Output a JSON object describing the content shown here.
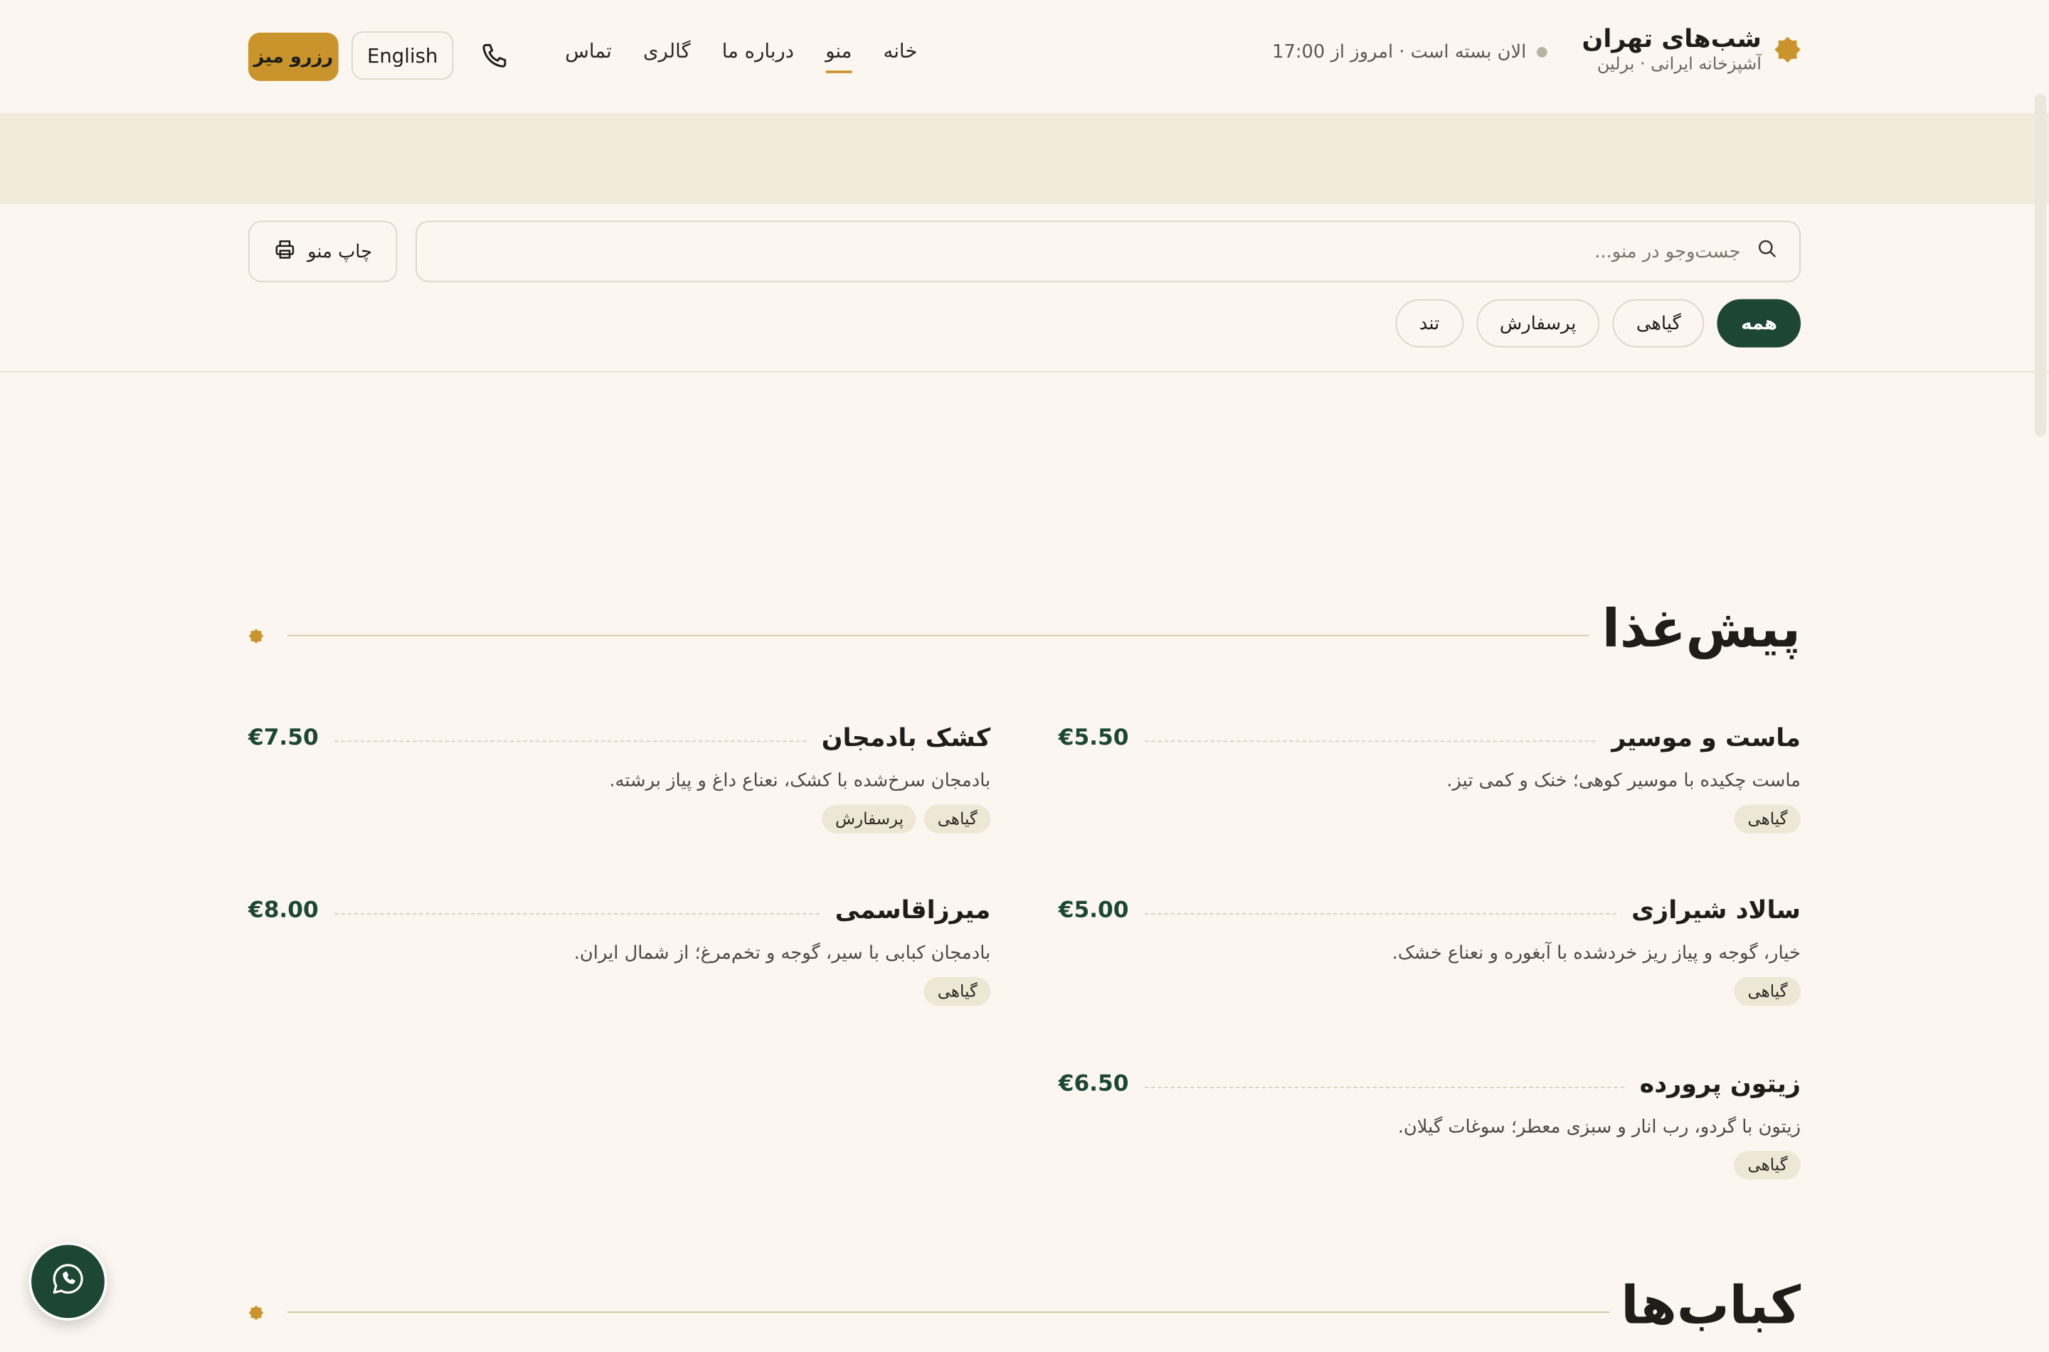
{
  "brand": {
    "name": "شب‌های تهران",
    "subtitle": "آشپزخانه ایرانی · برلین"
  },
  "status": {
    "text": "الان بسته است · امروز از 17:00"
  },
  "nav": {
    "items": [
      {
        "label": "خانه",
        "active": false
      },
      {
        "label": "منو",
        "active": true
      },
      {
        "label": "درباره ما",
        "active": false
      },
      {
        "label": "گالری",
        "active": false
      },
      {
        "label": "تماس",
        "active": false
      }
    ]
  },
  "header": {
    "language_label": "English",
    "reserve_label": "رزرو میز",
    "phone_icon": "phone-icon"
  },
  "search": {
    "placeholder": "جست‌وجو در منو...",
    "value": ""
  },
  "toolbar": {
    "print_label": "چاپ منو"
  },
  "filters": [
    {
      "label": "همه",
      "active": true
    },
    {
      "label": "گیاهی",
      "active": false
    },
    {
      "label": "پرسفارش",
      "active": false
    },
    {
      "label": "تند",
      "active": false
    }
  ],
  "sections": [
    {
      "title": "پیش‌غذا",
      "items": [
        {
          "name": "ماست و موسیر",
          "price": "€5.50",
          "description": "ماست چکیده با موسیر کوهی؛ خنک و کمی تیز.",
          "tags": [
            "گیاهی"
          ]
        },
        {
          "name": "کشک بادمجان",
          "price": "€7.50",
          "description": "بادمجان سرخ‌شده با کشک، نعناع داغ و پیاز برشته.",
          "tags": [
            "گیاهی",
            "پرسفارش"
          ]
        },
        {
          "name": "سالاد شیرازی",
          "price": "€5.00",
          "description": "خیار، گوجه و پیاز ریز خردشده با آبغوره و نعناع خشک.",
          "tags": [
            "گیاهی"
          ]
        },
        {
          "name": "میرزاقاسمی",
          "price": "€8.00",
          "description": "بادمجان کبابی با سیر، گوجه و تخم‌مرغ؛ از شمال ایران.",
          "tags": [
            "گیاهی"
          ]
        },
        {
          "name": "زیتون پرورده",
          "price": "€6.50",
          "description": "زیتون با گردو، رب انار و سبزی معطر؛ سوغات گیلان.",
          "tags": [
            "گیاهی"
          ]
        }
      ]
    },
    {
      "title": "کباب‌ها",
      "items": []
    }
  ],
  "colors": {
    "accent": "#c9942c",
    "primary": "#1e4634",
    "background": "#fbf7f0",
    "band": "#f2ebdc"
  },
  "floating": {
    "whatsapp_icon": "whatsapp-icon"
  }
}
